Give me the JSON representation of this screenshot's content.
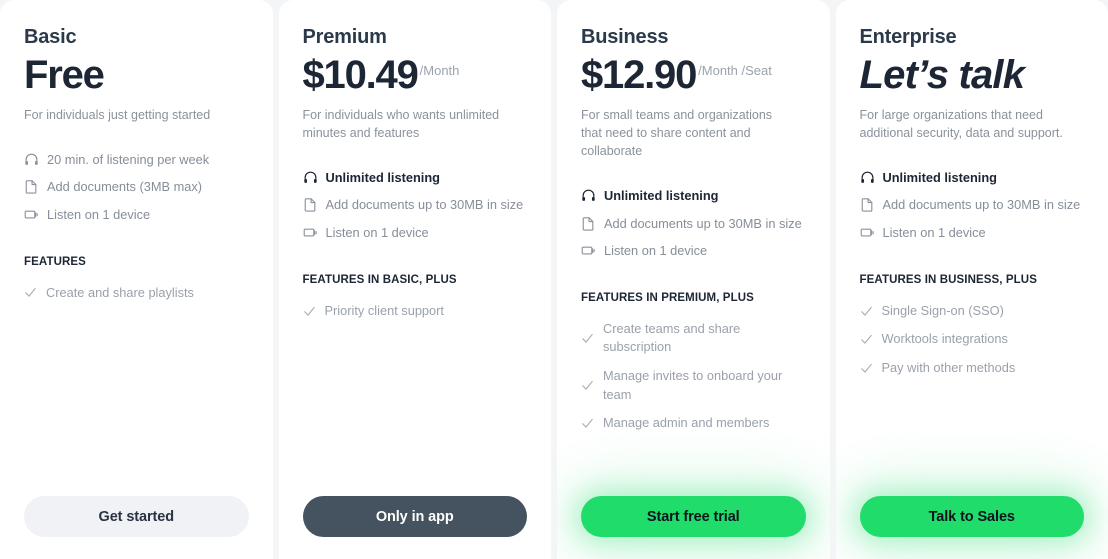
{
  "page": {
    "background_color": "#f4f5f7",
    "card_background_color": "#ffffff"
  },
  "colors": {
    "accent_green": "#1fdc6b",
    "dark_button": "#44535f",
    "neutral_button": "#f0f2f5",
    "heading_text": "#1c2634",
    "muted_text": "#8a929c"
  },
  "plans": [
    {
      "name": "Basic",
      "price": "Free",
      "price_italic": false,
      "price_unit": "",
      "tagline": "For individuals just getting started",
      "core_features": [
        {
          "icon": "headphones-icon",
          "text": "20 min. of listening per week",
          "emphasis": false
        },
        {
          "icon": "document-icon",
          "text": "Add documents (3MB max)",
          "emphasis": false
        },
        {
          "icon": "device-icon",
          "text": "Listen on 1 device",
          "emphasis": false
        }
      ],
      "features_heading": "FEATURES",
      "features": [
        "Create and share playlists"
      ],
      "cta_label": "Get started",
      "cta_style": "neutral"
    },
    {
      "name": "Premium",
      "price": "$10.49",
      "price_italic": false,
      "price_unit": "/Month",
      "tagline": "For individuals who wants unlimited minutes and features",
      "core_features": [
        {
          "icon": "headphones-icon",
          "text": "Unlimited listening",
          "emphasis": true
        },
        {
          "icon": "document-icon",
          "text": "Add documents up to 30MB in size",
          "emphasis": false
        },
        {
          "icon": "device-icon",
          "text": "Listen on 1 device",
          "emphasis": false
        }
      ],
      "features_heading": "FEATURES IN BASIC, PLUS",
      "features": [
        "Priority client support"
      ],
      "cta_label": "Only in app",
      "cta_style": "dark"
    },
    {
      "name": "Business",
      "price": "$12.90",
      "price_italic": false,
      "price_unit": "/Month /Seat",
      "tagline": "For small teams and organizations that need to share content and collaborate",
      "core_features": [
        {
          "icon": "headphones-icon",
          "text": "Unlimited listening",
          "emphasis": true
        },
        {
          "icon": "document-icon",
          "text": "Add documents up to 30MB in size",
          "emphasis": false
        },
        {
          "icon": "device-icon",
          "text": "Listen on 1 device",
          "emphasis": false
        }
      ],
      "features_heading": "FEATURES IN PREMIUM, PLUS",
      "features": [
        "Create teams and share subscription",
        "Manage invites to onboard your team",
        "Manage admin and members"
      ],
      "cta_label": "Start free trial",
      "cta_style": "green"
    },
    {
      "name": "Enterprise",
      "price": "Let’s talk",
      "price_italic": true,
      "price_unit": "",
      "tagline": "For large organizations that need additional security, data and support.",
      "core_features": [
        {
          "icon": "headphones-icon",
          "text": "Unlimited listening",
          "emphasis": true
        },
        {
          "icon": "document-icon",
          "text": "Add documents up to 30MB in size",
          "emphasis": false
        },
        {
          "icon": "device-icon",
          "text": "Listen on 1 device",
          "emphasis": false
        }
      ],
      "features_heading": "FEATURES IN BUSINESS, PLUS",
      "features": [
        "Single Sign-on (SSO)",
        "Worktools integrations",
        "Pay with other methods"
      ],
      "cta_label": "Talk to Sales",
      "cta_style": "green"
    }
  ]
}
